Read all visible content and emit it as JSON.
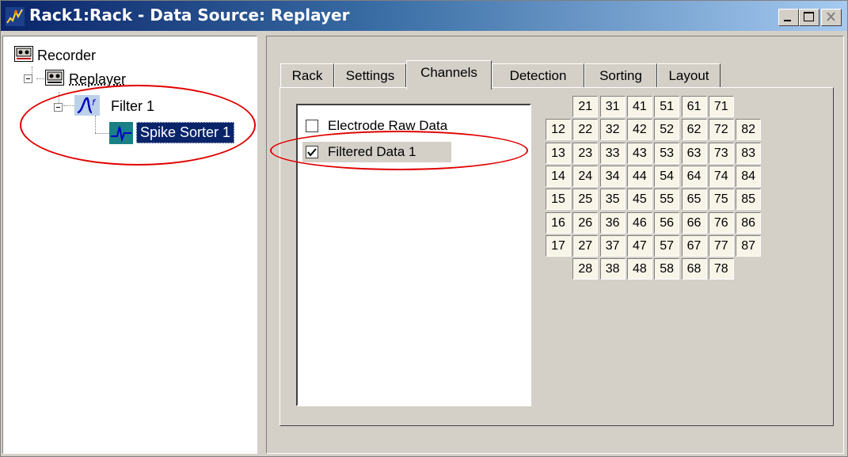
{
  "window": {
    "title": "Rack1:Rack - Data Source: Replayer"
  },
  "title_buttons": [
    "minimize-button",
    "maximize-button",
    "close-button"
  ],
  "tree": {
    "recorder": "Recorder",
    "replayer": "Replayer",
    "filter": "Filter 1",
    "spike_sorter": "Spike Sorter 1"
  },
  "tabs": [
    {
      "label": "Rack"
    },
    {
      "label": "Settings"
    },
    {
      "label": "Channels",
      "active": true
    },
    {
      "label": "Detection"
    },
    {
      "label": "Sorting"
    },
    {
      "label": "Layout"
    }
  ],
  "data_list": [
    {
      "label": "Electrode Raw Data",
      "checked": false
    },
    {
      "label": "Filtered Data 1",
      "checked": true
    }
  ],
  "channel_rows": [
    [
      "",
      "21",
      "31",
      "41",
      "51",
      "61",
      "71",
      ""
    ],
    [
      "12",
      "22",
      "32",
      "42",
      "52",
      "62",
      "72",
      "82"
    ],
    [
      "13",
      "23",
      "33",
      "43",
      "53",
      "63",
      "73",
      "83"
    ],
    [
      "14",
      "24",
      "34",
      "44",
      "54",
      "64",
      "74",
      "84"
    ],
    [
      "15",
      "25",
      "35",
      "45",
      "55",
      "65",
      "75",
      "85"
    ],
    [
      "16",
      "26",
      "36",
      "46",
      "56",
      "66",
      "76",
      "86"
    ],
    [
      "17",
      "27",
      "37",
      "47",
      "57",
      "67",
      "77",
      "87"
    ],
    [
      "",
      "28",
      "38",
      "48",
      "58",
      "68",
      "78",
      ""
    ]
  ],
  "colors": {
    "annotation": "#e00000",
    "selection": "#0a246a",
    "titlebar_start": "#0a246a",
    "titlebar_end": "#a6caf0"
  }
}
